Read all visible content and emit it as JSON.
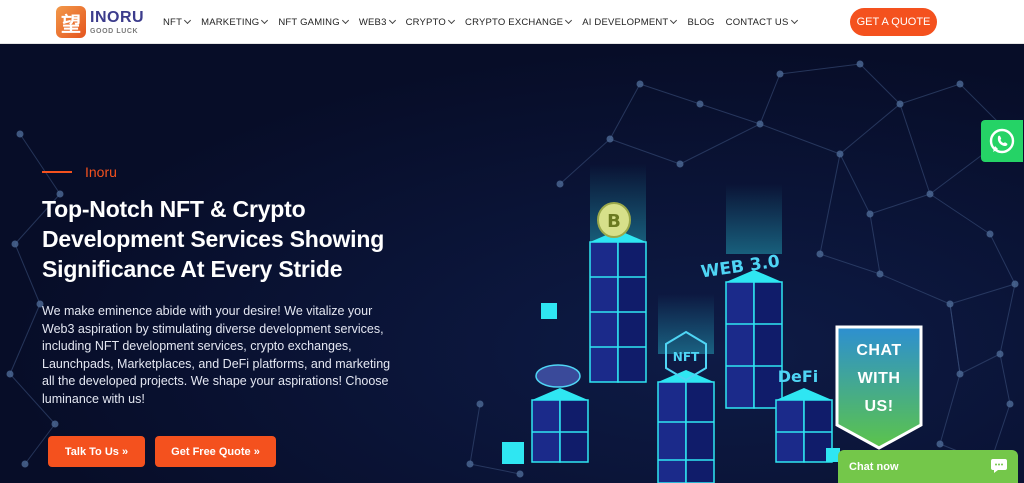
{
  "brand": {
    "logo_glyph": "望",
    "name": "INORU",
    "tagline": "GOOD LUCK"
  },
  "nav": {
    "items": [
      {
        "label": "NFT",
        "dropdown": true
      },
      {
        "label": "MARKETING",
        "dropdown": true
      },
      {
        "label": "NFT GAMING",
        "dropdown": true
      },
      {
        "label": "WEB3",
        "dropdown": true
      },
      {
        "label": "CRYPTO",
        "dropdown": true
      },
      {
        "label": "CRYPTO EXCHANGE",
        "dropdown": true
      },
      {
        "label": "AI DEVELOPMENT",
        "dropdown": true
      },
      {
        "label": "BLOG",
        "dropdown": false
      },
      {
        "label": "CONTACT US",
        "dropdown": true
      }
    ],
    "cta": "GET A QUOTE"
  },
  "hero": {
    "eyebrow": "Inoru",
    "title": "Top-Notch NFT & Crypto Development Services Showing Significance At Every Stride",
    "description": "We make eminence abide with your desire! We vitalize your Web3 aspiration by stimulating diverse development services, including NFT development services, crypto exchanges, Launchpads, Marketplaces, and DeFi platforms, and marketing all the developed projects. We shape your aspirations! Choose luminance with us!",
    "primary_button": "Talk To Us »",
    "secondary_button": "Get Free Quote »"
  },
  "illustration": {
    "labels": [
      "WEB 3.0",
      "NFT",
      "DeFi",
      "B"
    ]
  },
  "chat_widget": {
    "badge_lines": [
      "CHAT",
      "WITH",
      "US!"
    ],
    "bar_label": "Chat now"
  },
  "colors": {
    "accent": "#f4511e",
    "background": "#0a1130",
    "whatsapp": "#25d366",
    "chat": "#74c74a",
    "cube": "#2fe6f2"
  }
}
